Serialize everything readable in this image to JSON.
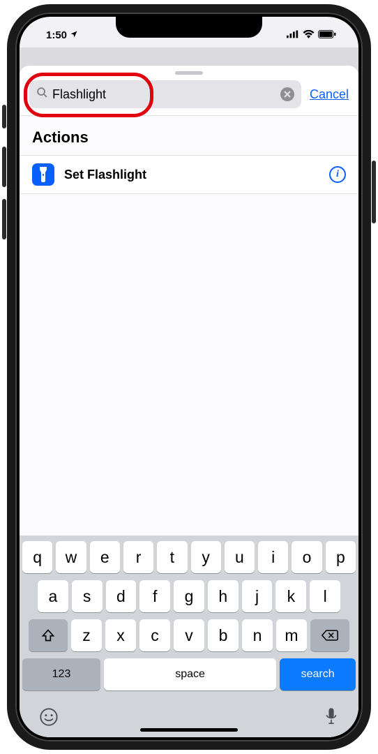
{
  "status": {
    "time": "1:50",
    "location_arrow": "➤"
  },
  "search": {
    "value": "Flashlight",
    "cancel": "Cancel"
  },
  "section": {
    "header": "Actions"
  },
  "actions": [
    {
      "label": "Set Flashlight"
    }
  ],
  "keyboard": {
    "row1": [
      "q",
      "w",
      "e",
      "r",
      "t",
      "y",
      "u",
      "i",
      "o",
      "p"
    ],
    "row2": [
      "a",
      "s",
      "d",
      "f",
      "g",
      "h",
      "j",
      "k",
      "l"
    ],
    "row3": [
      "z",
      "x",
      "c",
      "v",
      "b",
      "n",
      "m"
    ],
    "numbers": "123",
    "space": "space",
    "search": "search"
  }
}
